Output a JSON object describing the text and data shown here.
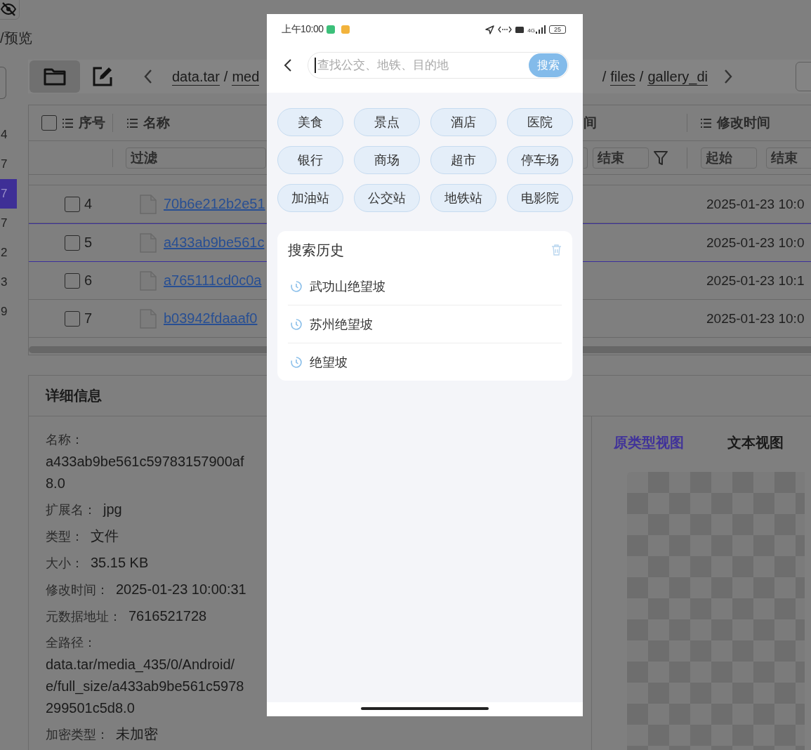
{
  "page_title": "/预览",
  "sidebar": {
    "items": [
      {
        "label": "4",
        "selected": false
      },
      {
        "label": "7",
        "selected": false
      },
      {
        "label": "7",
        "selected": true
      },
      {
        "label": "7",
        "selected": false
      },
      {
        "label": "2",
        "selected": false
      },
      {
        "label": "3",
        "selected": false
      },
      {
        "label": "9",
        "selected": false
      }
    ]
  },
  "toolbar": {
    "view_buttons": [
      {
        "kind": "folder",
        "selected": true
      },
      {
        "kind": "edit",
        "selected": false
      }
    ],
    "separator": "/",
    "breadcrumb_start": [
      "data.tar",
      "med"
    ],
    "breadcrumb_end": [
      "files",
      "gallery_di"
    ]
  },
  "table": {
    "select_all_checked": false,
    "columns": [
      {
        "label": "序号"
      },
      {
        "label": "名称"
      },
      {
        "label": "间"
      },
      {
        "label": "修改时间"
      }
    ],
    "filters": {
      "name": {
        "placeholder": "过滤"
      },
      "column_3": [
        {
          "placeholder": "结束"
        }
      ],
      "modified": [
        {
          "placeholder": "起始"
        },
        {
          "placeholder": "结束"
        }
      ]
    },
    "rows": [
      {
        "index": "4",
        "name": "70b6e212b2e51",
        "modified": "2025-01-23 10:0",
        "checked": false,
        "selected": false
      },
      {
        "index": "5",
        "name": "a433ab9be561c",
        "modified": "2025-01-23 10:0",
        "checked": false,
        "selected": true
      },
      {
        "index": "6",
        "name": "a765111cd0c0a",
        "modified": "2025-01-23 10:1",
        "checked": false,
        "selected": false
      },
      {
        "index": "7",
        "name": "b03942fdaaaf0",
        "modified": "2025-01-23 10:0",
        "checked": false,
        "selected": false
      }
    ]
  },
  "details": {
    "title": "详细信息",
    "fields": [
      {
        "kind": "stacked",
        "label": "名称：",
        "value": "a433ab9be561c59783157900af\n8.0"
      },
      {
        "kind": "inline",
        "label": "扩展名：",
        "value": "jpg"
      },
      {
        "kind": "inline",
        "label": "类型：",
        "value": "文件"
      },
      {
        "kind": "inline",
        "label": "大小：",
        "value": "35.15 KB"
      },
      {
        "kind": "inline",
        "label": "修改时间：",
        "value": "2025-01-23 10:00:31"
      },
      {
        "kind": "inline",
        "label": "元数据地址：",
        "value": "7616521728"
      },
      {
        "kind": "stacked",
        "label": "全路径：",
        "value": "data.tar/media_435/0/Android/\ne/full_size/a433ab9be561c5978\n299501c5d8.0"
      },
      {
        "kind": "inline",
        "label": "加密类型：",
        "value": "未加密"
      }
    ]
  },
  "preview": {
    "tabs": [
      {
        "label": "原类型视图",
        "selected": true
      },
      {
        "label": "文本视图",
        "selected": false
      }
    ]
  },
  "phone": {
    "status_bar": {
      "time": "上午10:00",
      "network": "4G",
      "battery": "25"
    },
    "search": {
      "placeholder": "查找公交、地铁、目的地",
      "button": "搜索"
    },
    "categories": [
      "美食",
      "景点",
      "酒店",
      "医院",
      "银行",
      "商场",
      "超市",
      "停车场",
      "加油站",
      "公交站",
      "地铁站",
      "电影院"
    ],
    "history": {
      "title": "搜索历史",
      "items": [
        "武功山绝望坡",
        "苏州绝望坡",
        "绝望坡"
      ]
    }
  }
}
